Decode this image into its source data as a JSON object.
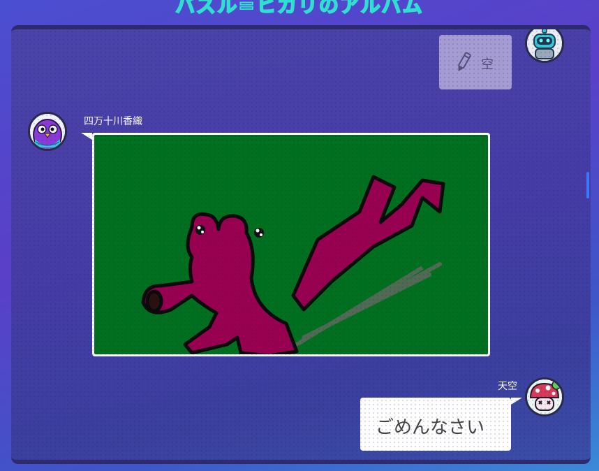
{
  "app": {
    "title": "バズル=ヒカリのアルバム"
  },
  "messages": [
    {
      "sender": "",
      "avatar": "robot-avatar",
      "side": "right",
      "type": "text-hidden",
      "icon": "pencil-icon",
      "text": "空"
    },
    {
      "sender": "四万十川香織",
      "avatar": "bird-avatar",
      "side": "left",
      "type": "drawing",
      "drawing": {
        "background": "#00701e",
        "figure_color": "#990050",
        "description_hidden": true
      }
    },
    {
      "sender": "天空",
      "avatar": "mushroom-avatar",
      "side": "right",
      "type": "text",
      "text": "ごめんなさい"
    }
  ],
  "colors": {
    "accent": "#3a78ff",
    "canvas": "#00701e",
    "figure": "#990050"
  }
}
